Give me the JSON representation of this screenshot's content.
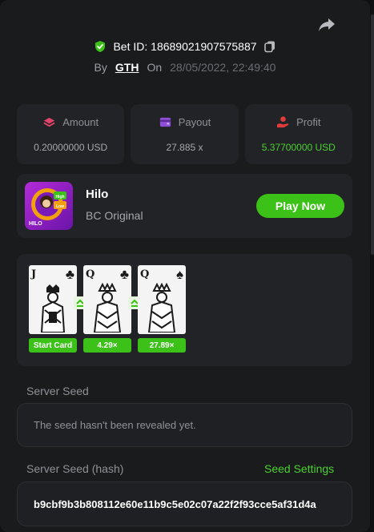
{
  "bet": {
    "id_text": "Bet ID: 18689021907575887",
    "by_label": "By",
    "user": "GTH",
    "on_label": "On",
    "date": "28/05/2022, 22:49:40"
  },
  "stats": [
    {
      "label": "Amount",
      "value": "0.20000000 USD",
      "icon": "coins-icon"
    },
    {
      "label": "Payout",
      "value": "27.885 x",
      "icon": "wallet-icon"
    },
    {
      "label": "Profit",
      "value": "5.37700000 USD",
      "icon": "profit-hand-icon"
    }
  ],
  "game": {
    "name": "Hilo",
    "subtitle": "BC Original",
    "play_label": "Play Now",
    "thumb_text": "HILO",
    "thumb_badge_high": "High",
    "thumb_badge_low": "Low"
  },
  "cards": [
    {
      "rank": "J",
      "suit": "♣",
      "label": "Start Card"
    },
    {
      "rank": "Q",
      "suit": "♣",
      "label": "4.29×"
    },
    {
      "rank": "Q",
      "suit": "♠",
      "label": "27.89×"
    }
  ],
  "server_seed": {
    "label": "Server Seed",
    "value": "The seed hasn't been revealed yet."
  },
  "server_seed_hash": {
    "label": "Server Seed (hash)",
    "settings_label": "Seed Settings",
    "value": "b9cbf9b3b808112e60e11b9c5e02c07a22f2f93cce5af31d4a"
  },
  "colors": {
    "accent_green": "#3bc117",
    "profit_green": "#4bd12f",
    "amount_icon": "#e2436b",
    "payout_icon": "#8f4ed8",
    "profit_icon": "#e23b3b"
  }
}
